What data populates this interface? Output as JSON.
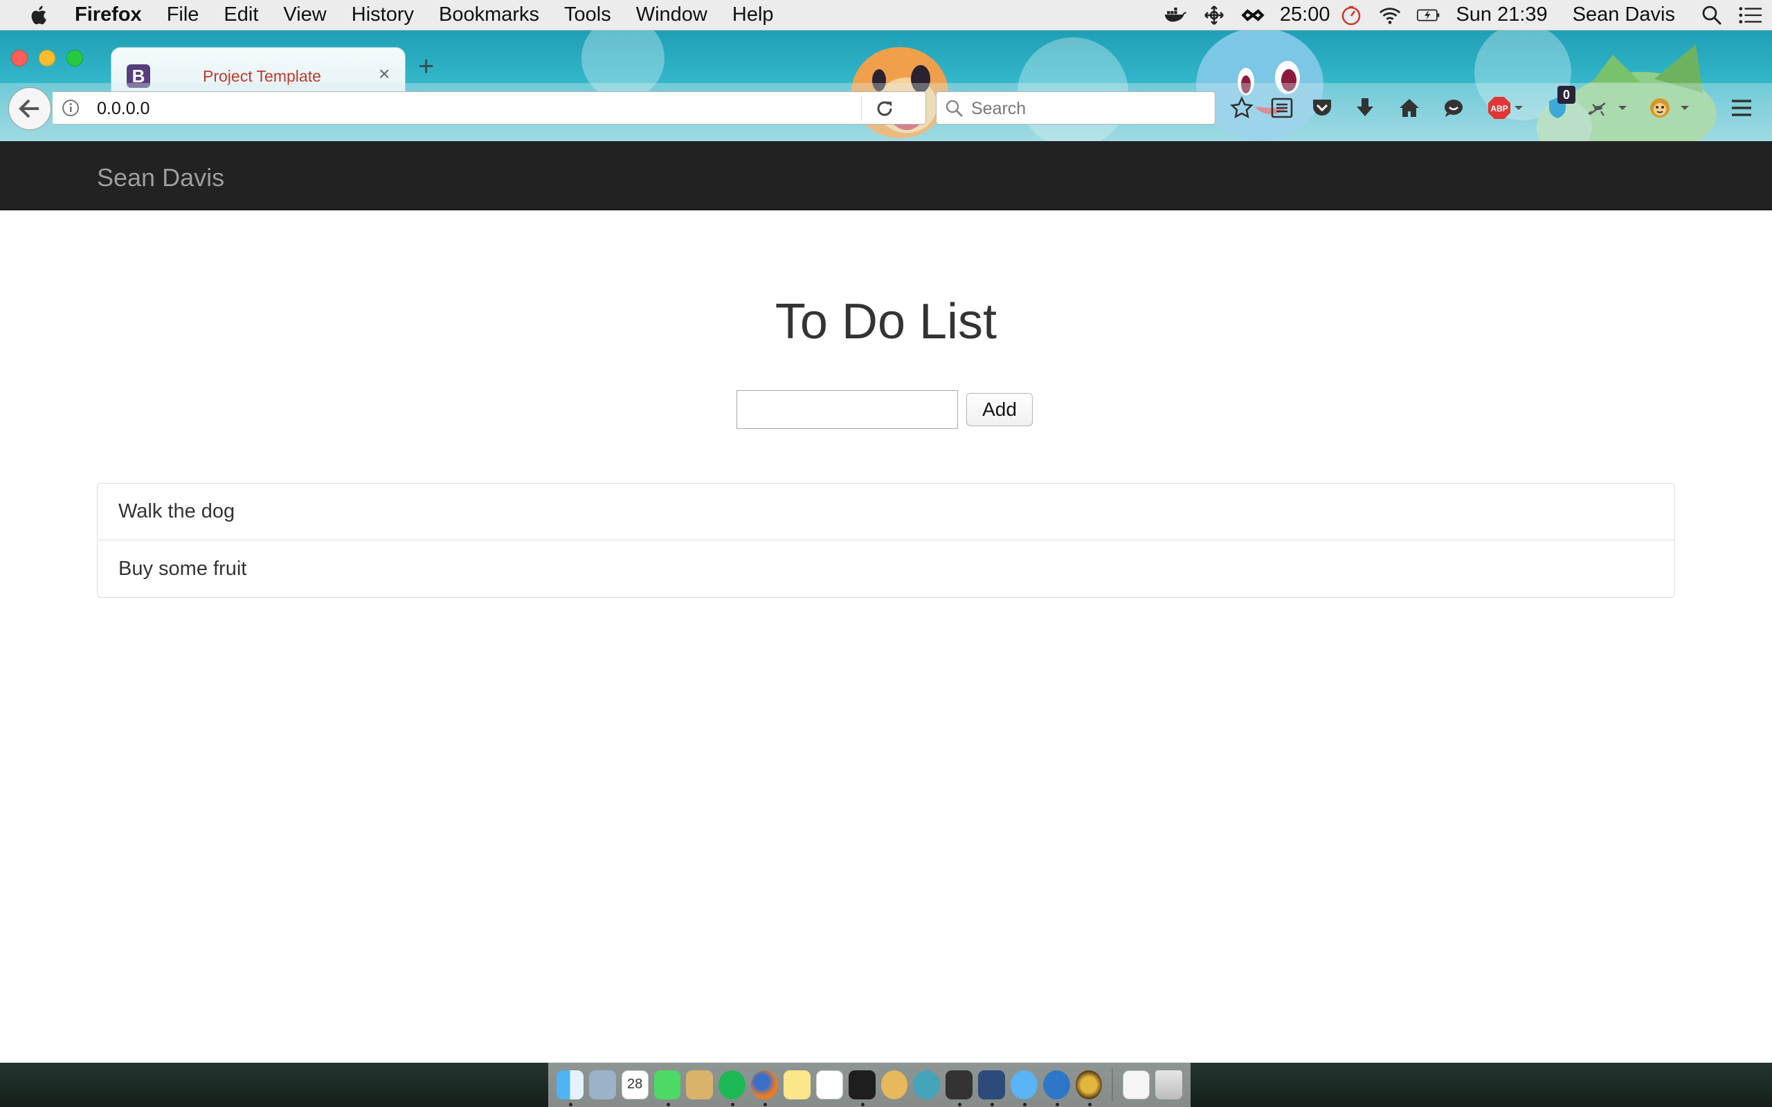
{
  "menubar": {
    "app_name": "Firefox",
    "items": [
      "File",
      "Edit",
      "View",
      "History",
      "Bookmarks",
      "Tools",
      "Window",
      "Help"
    ],
    "timer": "25:00",
    "clock": "Sun 21:39",
    "user": "Sean Davis"
  },
  "browser": {
    "tab": {
      "favicon_letter": "B",
      "title": "Project Template",
      "close": "×"
    },
    "new_tab": "+",
    "url": "0.0.0.0",
    "search_placeholder": "Search",
    "badge_count": "0",
    "abp_label": "ABP"
  },
  "site": {
    "brand": "Sean Davis",
    "title": "To Do List",
    "add_label": "Add",
    "todos": [
      "Walk the dog",
      "Buy some fruit"
    ]
  },
  "dock": {
    "calendar_day": "28"
  }
}
